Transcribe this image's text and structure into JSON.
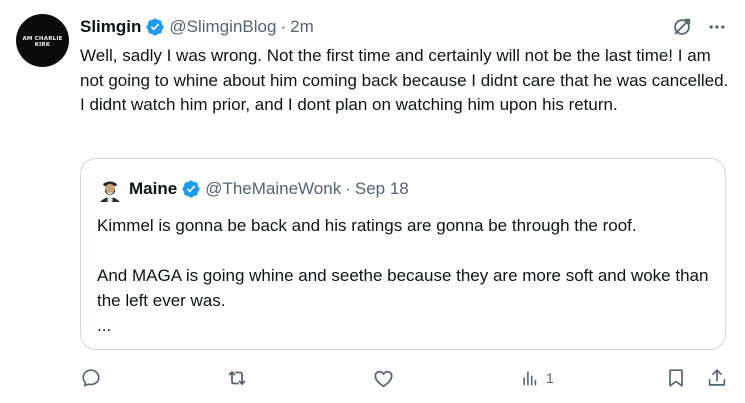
{
  "tweet": {
    "author": {
      "name": "Slimgin",
      "handle": "@SlimginBlog",
      "avatar_text": "AM CHARLIE KIRK",
      "verified": true
    },
    "separator": "·",
    "time": "2m",
    "text": "Well, sadly I was wrong. Not the first time and certainly will not be the last time! I am not going to whine about him coming back because I didnt care that he was cancelled. I didnt watch him prior, and I dont plan on watching him upon his return."
  },
  "quote": {
    "author": {
      "name": "Maine",
      "handle": "@TheMaineWonk",
      "verified": true
    },
    "separator": "·",
    "time": "Sep 18",
    "paragraphs": [
      "Kimmel is gonna be back and his ratings are gonna be through the roof.",
      "And MAGA is going whine and seethe because they are more soft and woke than the left ever was.",
      "..."
    ]
  },
  "actions": {
    "reply_icon": "reply-icon",
    "retweet_icon": "retweet-icon",
    "like_icon": "heart-icon",
    "views_icon": "views-icon",
    "views_count": "1",
    "bookmark_icon": "bookmark-icon",
    "share_icon": "share-icon"
  },
  "colors": {
    "verified_blue": "#1d9bf0",
    "secondary_text": "#536471",
    "border": "#cfd9de",
    "text": "#0f1419"
  }
}
